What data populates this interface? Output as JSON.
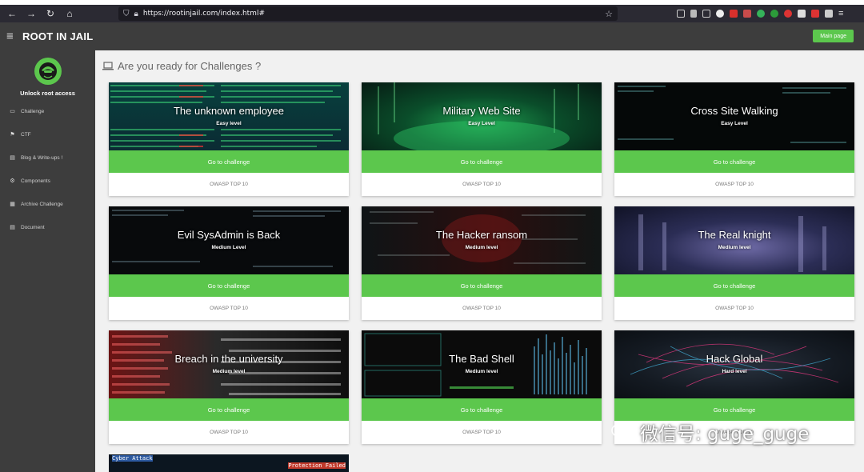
{
  "browser": {
    "url": "https://rootinjail.com/index.html#"
  },
  "header": {
    "brand": "ROOT IN JAIL",
    "main_page_label": "Main page"
  },
  "sidebar": {
    "title": "Unlock root access",
    "items": [
      {
        "label": "Challenge",
        "icon": "monitor-icon"
      },
      {
        "label": "CTF",
        "icon": "flag-icon"
      },
      {
        "label": "Blog & Write-ups !",
        "icon": "book-icon"
      },
      {
        "label": "Components",
        "icon": "gears-icon"
      },
      {
        "label": "Archive Challenge",
        "icon": "archive-icon"
      },
      {
        "label": "Document",
        "icon": "book-icon"
      }
    ]
  },
  "main": {
    "heading": "Are you ready for Challenges ?",
    "cards": [
      {
        "title": "The unknown employee",
        "level": "Easy level",
        "button": "Go to challenge",
        "footer": "OWASP TOP 10"
      },
      {
        "title": "Military Web Site",
        "level": "Easy Level",
        "button": "Go to challenge",
        "footer": "OWASP TOP 10"
      },
      {
        "title": "Cross Site Walking",
        "level": "Easy Level",
        "button": "Go to challenge",
        "footer": "OWASP TOP 10"
      },
      {
        "title": "Evil SysAdmin is Back",
        "level": "Medium Level",
        "button": "Go to challenge",
        "footer": "OWASP TOP 10"
      },
      {
        "title": "The Hacker ransom",
        "level": "Medium level",
        "button": "Go to challenge",
        "footer": "OWASP TOP 10"
      },
      {
        "title": "The Real knight",
        "level": "Medium level",
        "button": "Go to challenge",
        "footer": "OWASP TOP 10"
      },
      {
        "title": "Breach in the university",
        "level": "Medium level",
        "button": "Go to challenge",
        "footer": "OWASP TOP 10"
      },
      {
        "title": "The Bad Shell",
        "level": "Medium level",
        "button": "Go to challenge",
        "footer": "OWASP TOP 10"
      },
      {
        "title": "Hack Global",
        "level": "Hard level",
        "button": "Go to challenge",
        "footer": "OWASP TOP 10"
      }
    ],
    "partial_card_text": {
      "a": "Cyber Attack",
      "b": "Protection Failed"
    }
  },
  "watermark": "微信号: guge_guge",
  "colors": {
    "accent_green": "#5cc74d",
    "sidebar_bg": "#3d3d3d",
    "content_bg": "#f1f1f1"
  }
}
